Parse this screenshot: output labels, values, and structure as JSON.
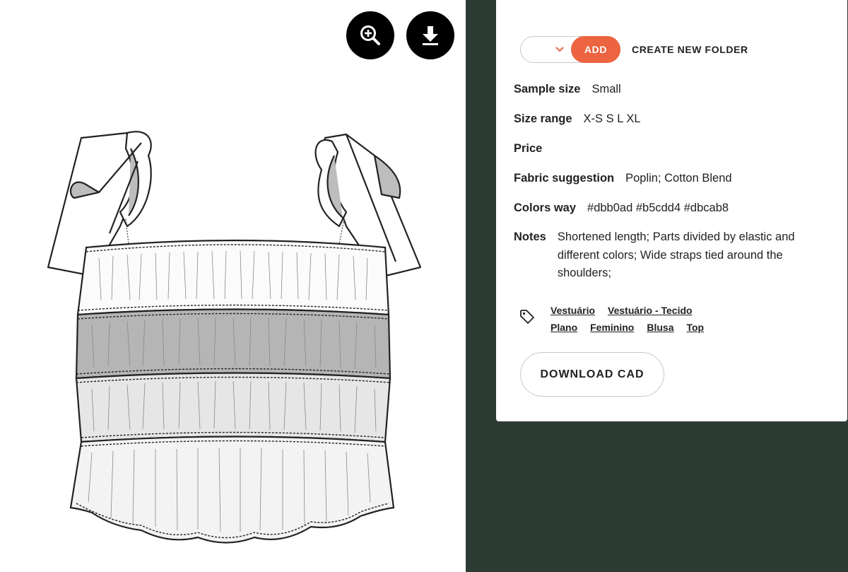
{
  "toolbar": {
    "zoom_icon": "zoom-in-icon",
    "download_icon": "download-icon"
  },
  "folder": {
    "selected": "",
    "add_label": "ADD",
    "create_label": "CREATE NEW FOLDER"
  },
  "details": {
    "sample_size": {
      "label": "Sample size",
      "value": "Small"
    },
    "size_range": {
      "label": "Size range",
      "value": "X-S S L XL"
    },
    "price": {
      "label": "Price",
      "value": ""
    },
    "fabric": {
      "label": "Fabric suggestion",
      "value": "Poplin; Cotton Blend"
    },
    "colors_way": {
      "label": "Colors way",
      "value": "#dbb0ad #b5cdd4 #dbcab8"
    },
    "notes": {
      "label": "Notes",
      "value": "Shortened length; Parts divided by elastic and different colors; Wide straps tied around the shoulders;"
    }
  },
  "tags": [
    "Vestuário",
    "Vestuário - Tecido",
    "Plano",
    "Feminino",
    "Blusa",
    "Top"
  ],
  "download_cad_label": "DOWNLOAD CAD",
  "colors": {
    "accent": "#ec6440",
    "background_dark": "#2d3b35"
  }
}
